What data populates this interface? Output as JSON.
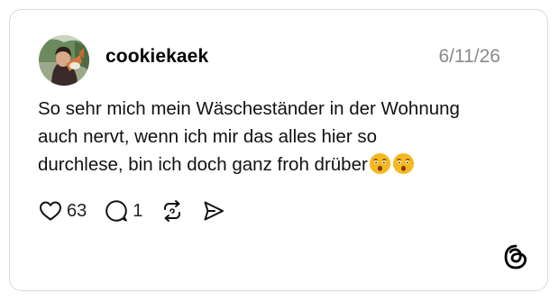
{
  "post": {
    "username": "cookiekaek",
    "date": "6/11/26",
    "text_lines": [
      "So sehr mich mein Wäscheständer in der Wohnung",
      "auch nervt, wenn ich mir das alles hier so",
      "durchlese, bin ich doch ganz froh drüber"
    ],
    "emojis": [
      "face-with-open-mouth-emoji",
      "face-with-open-mouth-emoji"
    ]
  },
  "actions": {
    "likes": "63",
    "replies": "1",
    "icons": [
      "heart-icon",
      "comment-icon",
      "repost-icon",
      "share-icon"
    ]
  },
  "branding": {
    "logo": "threads-logo-icon"
  },
  "colors": {
    "border": "#d9d9d9",
    "date": "#8a8a8a",
    "text": "#111111",
    "emoji": "#f5b81f"
  }
}
